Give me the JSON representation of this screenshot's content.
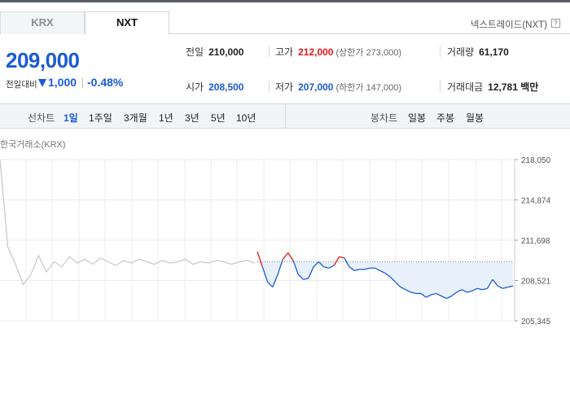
{
  "tabs": [
    {
      "label": "KRX"
    },
    {
      "label": "NXT"
    }
  ],
  "exchange_label": "넥스트레이드(NXT)",
  "help_icon": "?",
  "price": {
    "current": "209,000",
    "change_label": "전일대비",
    "change_value": "1,000",
    "change_rate": "-0.48%",
    "direction": "down"
  },
  "stats": {
    "prev_close": {
      "label": "전일",
      "value": "210,000"
    },
    "high": {
      "label": "고가",
      "value": "212,000",
      "limit_label": "(상한가 273,000)"
    },
    "volume": {
      "label": "거래량",
      "value": "61,170"
    },
    "open": {
      "label": "시가",
      "value": "208,500"
    },
    "low": {
      "label": "저가",
      "value": "207,000",
      "limit_label": "(하한가 147,000)"
    },
    "trade_amount": {
      "label": "거래대금",
      "value": "12,781",
      "unit": "백만"
    }
  },
  "period_bar": {
    "line_label": "선차트",
    "line_options": [
      "1일",
      "1주일",
      "3개월",
      "1년",
      "3년",
      "5년",
      "10년"
    ],
    "line_active": "1일",
    "candle_label": "봉차트",
    "candle_options": [
      "일봉",
      "주봉",
      "월봉"
    ]
  },
  "chart_label": "한국거래소(KRX)",
  "colors": {
    "up": "#e0191e",
    "down": "#1a5bd6",
    "krx_line": "#c8c8c8",
    "fill": "#e8f0fb"
  },
  "chart_data": {
    "type": "line",
    "y_ticks": [
      "218,050",
      "214,874",
      "211,698",
      "208,521",
      "205,345"
    ],
    "ylim": [
      205345,
      218050
    ],
    "reference": 210000,
    "series": [
      {
        "values": [
          218050,
          211200,
          209800,
          208200,
          209000,
          210500,
          209200,
          210000,
          209600,
          210400,
          209900,
          210200,
          209800,
          210300,
          210000,
          209700,
          210100,
          209900,
          210200,
          210000,
          209800,
          210100,
          209900,
          210000,
          210200,
          209800,
          210000,
          209900,
          210100,
          210000,
          209800,
          210000,
          210100,
          209900
        ]
      },
      {
        "values": [
          210800,
          209600,
          208400,
          208000,
          209000,
          210200,
          210700,
          210100,
          209000,
          208600,
          208700,
          209600,
          210000,
          209600,
          209500,
          209700,
          210400,
          210300,
          209600,
          209300,
          209400,
          209400,
          209500,
          209500,
          209300,
          209100,
          208800,
          208400,
          208000,
          207800,
          207600,
          207500,
          207500,
          207200,
          207400,
          207500,
          207300,
          207100,
          207300,
          207600,
          207800,
          207600,
          207700,
          207900,
          207800,
          207900,
          208600,
          208100,
          207900,
          208000,
          208100
        ]
      }
    ]
  }
}
